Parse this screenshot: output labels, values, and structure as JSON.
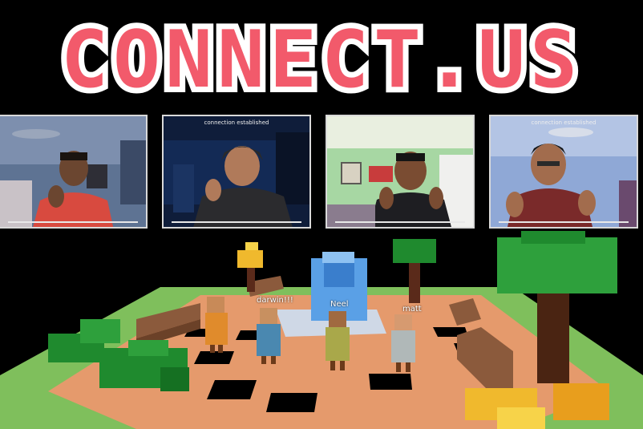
{
  "app": {
    "title": "CONNECT.US"
  },
  "colors": {
    "logo_fill": "#f25a6b",
    "logo_outline": "#ffffff",
    "background": "#000000"
  },
  "video_tiles": [
    {
      "status": ""
    },
    {
      "status": "connection established"
    },
    {
      "status": ""
    },
    {
      "status": "connection established"
    }
  ],
  "players": [
    {
      "name": ""
    },
    {
      "name": "darwin!!!"
    },
    {
      "name": "Neel"
    },
    {
      "name": "matt"
    }
  ]
}
